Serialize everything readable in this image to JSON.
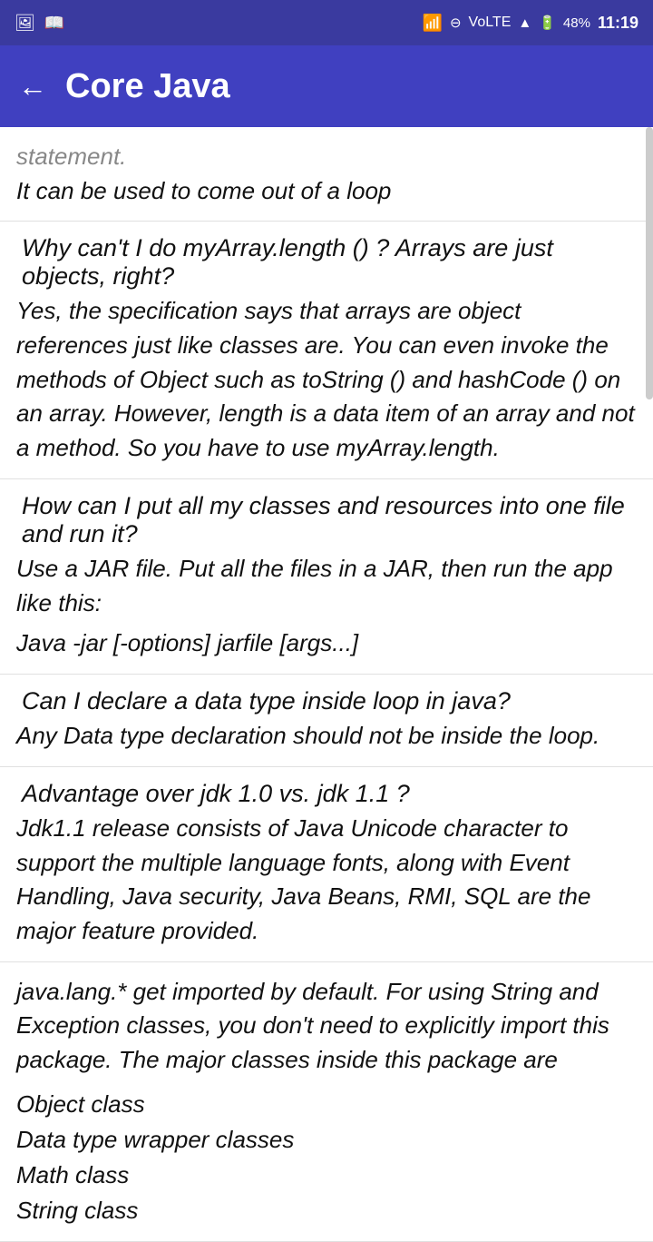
{
  "statusBar": {
    "bluetooth": "⚡",
    "block": "⊖",
    "volte": "VoLTE",
    "signal": "▲",
    "battery": "48%",
    "time": "11:19"
  },
  "appBar": {
    "backLabel": "←",
    "title": "Core Java"
  },
  "sections": [
    {
      "id": "section-break",
      "type": "plain",
      "text": "statement.\nIt can be used to come out of a loop"
    },
    {
      "id": "section-array-length",
      "type": "qa",
      "question": " Why can't I do myArray.length () ? Arrays are just objects, right?",
      "answer": "Yes, the specification says that arrays are object references just like classes are. You can even invoke the methods of Object such as toString () and hashCode () on an array. However, length is a data item of an array and not a method. So you have to use myArray.length."
    },
    {
      "id": "section-jar",
      "type": "qa-code",
      "question": " How can I put all my classes and resources into one file and run it?",
      "answer": "Use a JAR file. Put all the files in a JAR, then run the app like this:",
      "code": "Java -jar [-options] jarfile [args...]"
    },
    {
      "id": "section-datatype",
      "type": "qa",
      "question": " Can I declare a data type inside loop in java?",
      "answer": "Any Data type declaration should not be inside the loop."
    },
    {
      "id": "section-jdk",
      "type": "qa",
      "question": "Advantage over jdk 1.0 vs. jdk 1.1 ?",
      "answer": "Jdk1.1 release consists of Java Unicode character to support the multiple language fonts, along with Event Handling, Java security, Java Beans, RMI, SQL are the major feature provided."
    },
    {
      "id": "section-javalang",
      "type": "plain-list",
      "text": "java.lang.* get imported by default. For using String and Exception classes, you don't need to explicitly import this package. The major classes inside this package are",
      "listItems": [
        "Object class",
        "Data type wrapper classes",
        "Math class",
        "String class"
      ]
    }
  ]
}
